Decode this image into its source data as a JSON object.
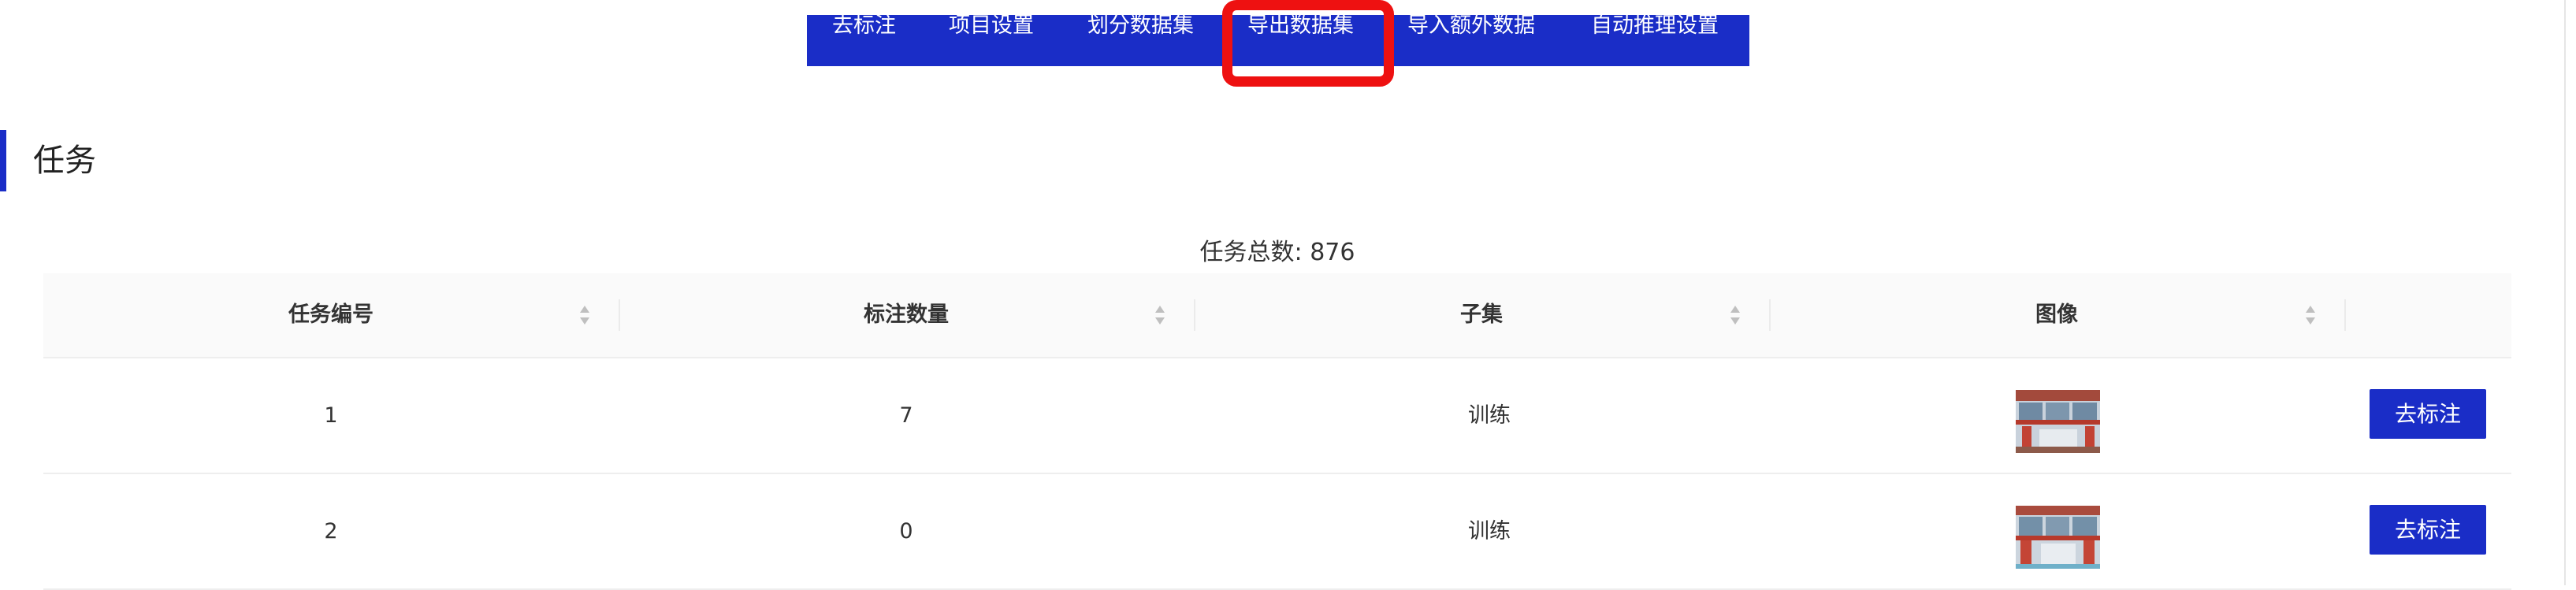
{
  "nav": {
    "items": [
      {
        "label": "去标注"
      },
      {
        "label": "项目设置"
      },
      {
        "label": "划分数据集"
      },
      {
        "label": "导出数据集"
      },
      {
        "label": "导入额外数据"
      },
      {
        "label": "自动推理设置"
      }
    ],
    "highlighted_item": "导出数据集",
    "highlight_color": "#ee1111",
    "bar_color": "#1a2dc7"
  },
  "section": {
    "title": "任务"
  },
  "summary": {
    "task_total": "任务总数: 876"
  },
  "table": {
    "columns": [
      "任务编号",
      "标注数量",
      "子集",
      "图像"
    ],
    "rows": [
      {
        "id": "1",
        "label_count": "7",
        "subset": "训练",
        "image": "thumbnail",
        "action": "去标注"
      },
      {
        "id": "2",
        "label_count": "0",
        "subset": "训练",
        "image": "thumbnail",
        "action": "去标注"
      }
    ]
  },
  "icons": {
    "sort": "sort-caret-icon",
    "thumbnail": "image-thumbnail-icon"
  },
  "colors": {
    "accent": "#1a2dc7",
    "header_bg": "#fafafa"
  }
}
